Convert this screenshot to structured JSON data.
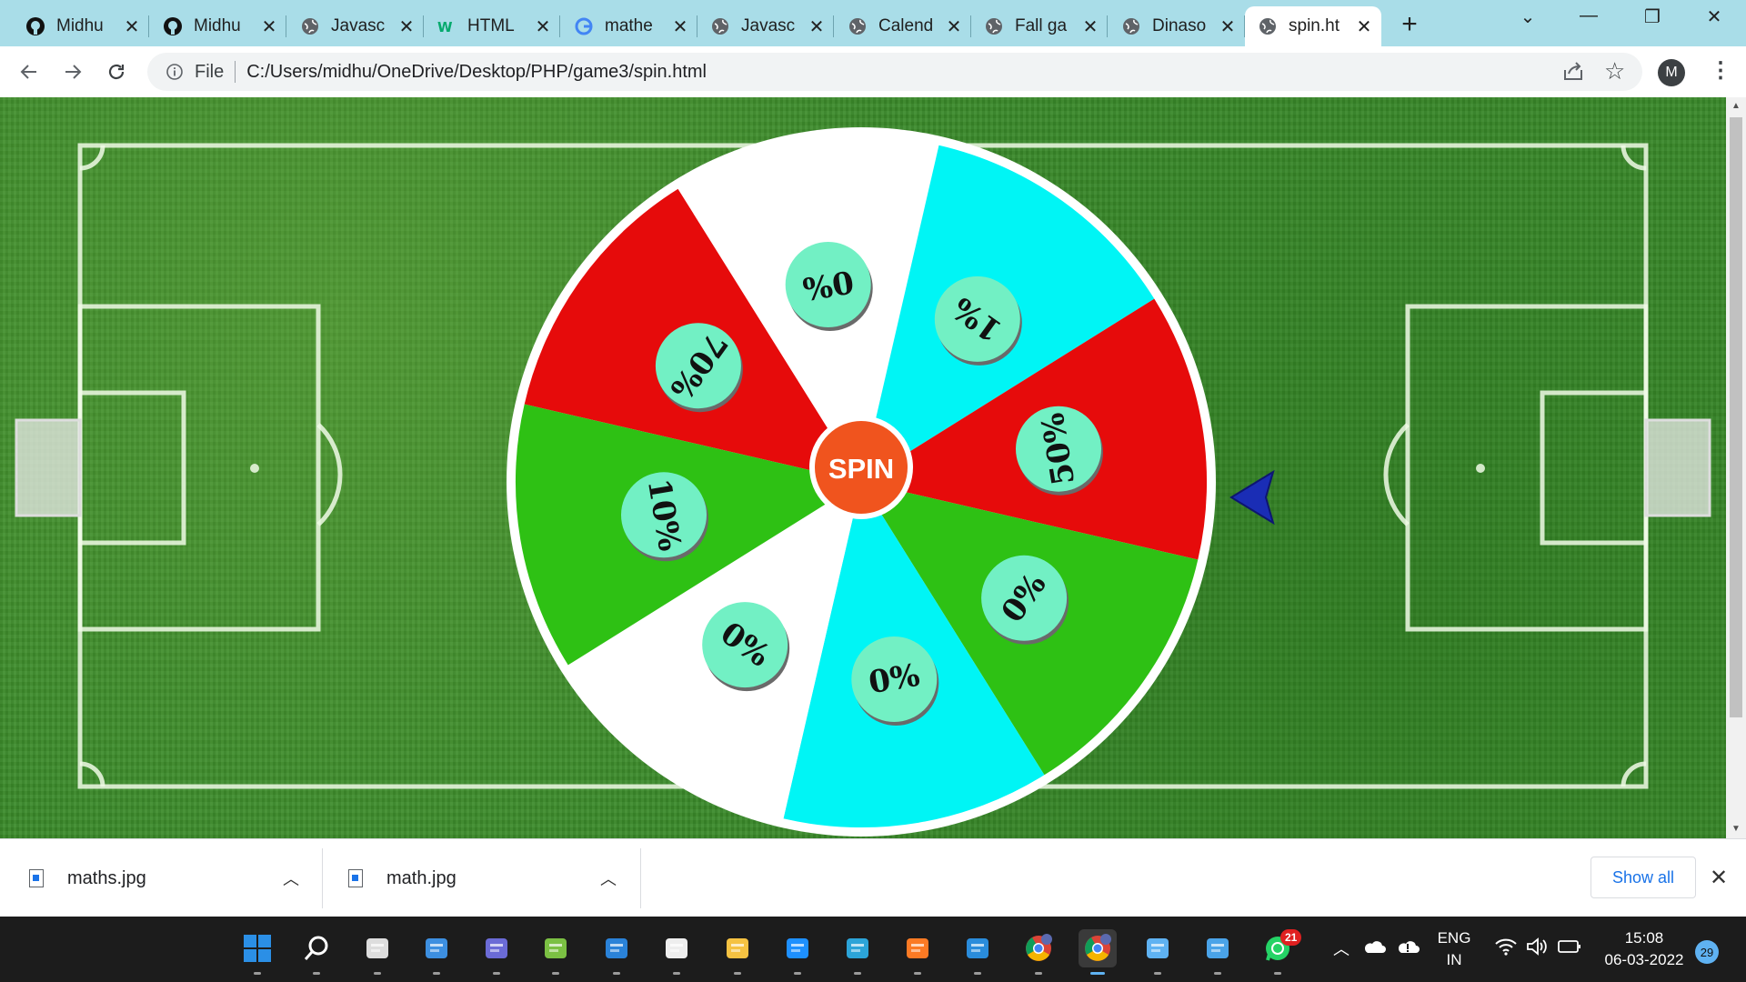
{
  "browser": {
    "tabs": [
      {
        "title": "Midhu",
        "favicon": "github-icon"
      },
      {
        "title": "Midhu",
        "favicon": "github-icon"
      },
      {
        "title": "Javasc",
        "favicon": "globe-icon"
      },
      {
        "title": "HTML",
        "favicon": "w3-icon"
      },
      {
        "title": "mathe",
        "favicon": "google-icon"
      },
      {
        "title": "Javasc",
        "favicon": "globe-icon"
      },
      {
        "title": "Calend",
        "favicon": "globe-icon"
      },
      {
        "title": "Fall ga",
        "favicon": "globe-icon"
      },
      {
        "title": "Dinaso",
        "favicon": "globe-icon"
      },
      {
        "title": "spin.ht",
        "favicon": "globe-icon",
        "active": true
      }
    ],
    "address": {
      "scheme_label": "File",
      "url": "C:/Users/midhu/OneDrive/Desktop/PHP/game3/spin.html"
    },
    "profile_initial": "M"
  },
  "wheel": {
    "center_label": "SPIN",
    "center_color": "#f0541e",
    "segments": [
      {
        "label": "70%",
        "color": "#e60b0b"
      },
      {
        "label": "0%",
        "color": "#ffffff"
      },
      {
        "label": "1%",
        "color": "#00f5f5"
      },
      {
        "label": "50%",
        "color": "#e60b0b"
      },
      {
        "label": "0%",
        "color": "#2ec114"
      },
      {
        "label": "0%",
        "color": "#00f5f5"
      },
      {
        "label": "0%",
        "color": "#ffffff"
      },
      {
        "label": "10%",
        "color": "#2ec114"
      }
    ],
    "pointer_color": "#1a2db5"
  },
  "downloads": {
    "items": [
      {
        "name": "maths.jpg"
      },
      {
        "name": "math.jpg"
      }
    ],
    "show_all_label": "Show all"
  },
  "taskbar": {
    "apps": [
      "windows-start-icon",
      "search-icon",
      "task-view-icon",
      "widgets-icon",
      "teams-chat-icon",
      "paint-icon",
      "mail-icon",
      "store-icon",
      "file-explorer-icon",
      "snipping-icon",
      "edge-icon",
      "xampp-icon",
      "vscode-icon",
      "chrome-profile-icon",
      "chrome-icon",
      "notepad-icon",
      "photos-icon",
      "whatsapp-icon"
    ],
    "whatsapp_badge": "21",
    "language_line1": "ENG",
    "language_line2": "IN",
    "time": "15:08",
    "date": "06-03-2022",
    "notifications_count": "29"
  }
}
